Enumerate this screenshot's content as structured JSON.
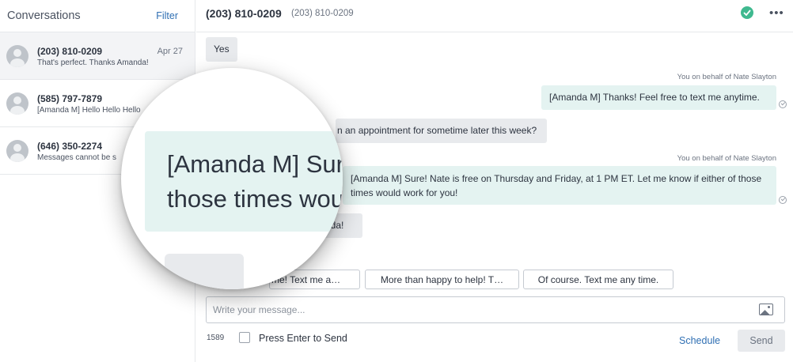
{
  "sidebar": {
    "title": "Conversations",
    "filter_label": "Filter",
    "conversations": [
      {
        "phone": "(203) 810-0209",
        "date": "Apr 27",
        "preview": "That's perfect. Thanks Amanda!"
      },
      {
        "phone": "(585) 797-7879",
        "date": "",
        "preview": "[Amanda M] Hello Hello Hello"
      },
      {
        "phone": "(646) 350-2274",
        "date": "",
        "preview": "Messages cannot be s"
      }
    ]
  },
  "header": {
    "title": "(203) 810-0209",
    "subtitle": "(203) 810-0209",
    "status_icon": "check-circle-icon",
    "status_color": "#3fb98f",
    "more_label": "•••"
  },
  "messages": [
    {
      "direction": "in",
      "text": "Yes"
    },
    {
      "direction": "out",
      "meta": "You on behalf of Nate Slayton",
      "text": "[Amanda M] Thanks! Feel free to text me anytime."
    },
    {
      "direction": "in",
      "text": "n an appointment for sometime later this week?"
    },
    {
      "direction": "out",
      "meta": "You on behalf of Nate Slayton",
      "text": "[Amanda M] Sure! Nate is free on Thursday and Friday, at 1 PM ET. Let me know if either of those times would work for you!"
    },
    {
      "direction": "in",
      "text": "nda!"
    }
  ],
  "magnifier": {
    "line1": "[Amanda M] Sur",
    "line2": "those times wou"
  },
  "suggestions": [
    "me! Text me a…",
    "More than happy to help! T…",
    "Of course. Text me any time."
  ],
  "compose": {
    "placeholder": "Write your message...",
    "char_count": "1589",
    "enter_label": "Press Enter to Send",
    "schedule_label": "Schedule",
    "send_label": "Send"
  },
  "colors": {
    "accent": "#2f6fb3",
    "outgoing_bubble": "#e4f3f1",
    "incoming_bubble": "#e8eaed"
  }
}
